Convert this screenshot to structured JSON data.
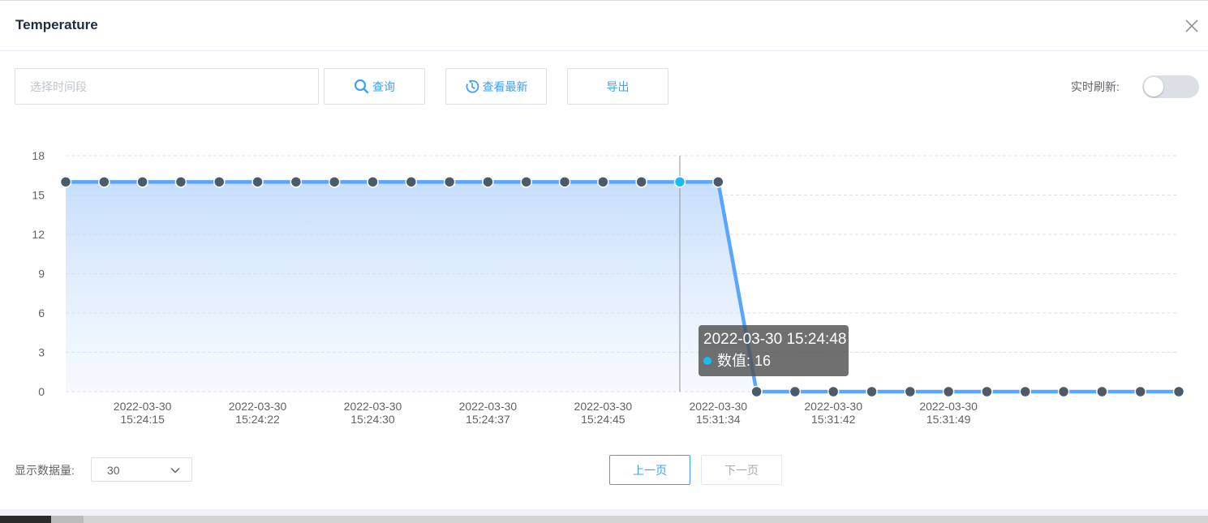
{
  "dialog": {
    "title": "Temperature"
  },
  "toolbar": {
    "range_placeholder": "选择时间段",
    "query_label": "查询",
    "latest_label": "查看最新",
    "export_label": "导出",
    "realtime_label": "实时刷新:",
    "realtime_on": false
  },
  "tooltip": {
    "time": "2022-03-30 15:24:48",
    "value_text": "数值: 16"
  },
  "footer": {
    "count_label": "显示数据量:",
    "count_value": "30",
    "prev_label": "上一页",
    "next_label": "下一页"
  },
  "colors": {
    "accent": "#409eff",
    "line": "#5aa5ff",
    "point": "#4a5b6a",
    "highlight_point": "#1bbcf3"
  },
  "chart_data": {
    "type": "area",
    "xlabel": "",
    "ylabel": "",
    "ylim": [
      0,
      18
    ],
    "yticks": [
      0,
      3,
      6,
      9,
      12,
      15,
      18
    ],
    "grid": true,
    "x_tick_labels": [
      {
        "index": 2,
        "date": "2022-03-30",
        "time": "15:24:15"
      },
      {
        "index": 5,
        "date": "2022-03-30",
        "time": "15:24:22"
      },
      {
        "index": 8,
        "date": "2022-03-30",
        "time": "15:24:30"
      },
      {
        "index": 11,
        "date": "2022-03-30",
        "time": "15:24:37"
      },
      {
        "index": 14,
        "date": "2022-03-30",
        "time": "15:24:45"
      },
      {
        "index": 17,
        "date": "2022-03-30",
        "time": "15:31:34"
      },
      {
        "index": 20,
        "date": "2022-03-30",
        "time": "15:31:42"
      },
      {
        "index": 23,
        "date": "2022-03-30",
        "time": "15:31:49"
      }
    ],
    "highlight_index": 16,
    "series": [
      {
        "values": [
          16,
          16,
          16,
          16,
          16,
          16,
          16,
          16,
          16,
          16,
          16,
          16,
          16,
          16,
          16,
          16,
          16,
          16,
          0,
          0,
          0,
          0,
          0,
          0,
          0,
          0,
          0,
          0,
          0,
          0
        ]
      }
    ]
  }
}
